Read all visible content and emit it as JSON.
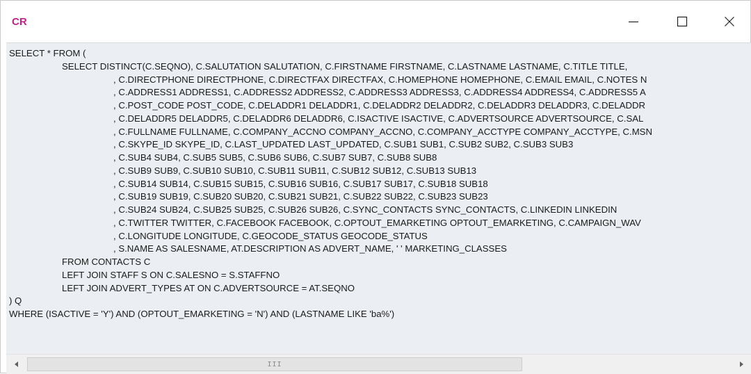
{
  "window": {
    "title": "CR",
    "title_color": "#c0228a",
    "controls": {
      "minimize_icon": "minimize-icon",
      "maximize_icon": "maximize-icon",
      "close_icon": "close-icon"
    }
  },
  "editor": {
    "background": "#ebeef2",
    "lines": [
      {
        "indent": 0,
        "text": "SELECT * FROM ("
      },
      {
        "indent": 1,
        "text": "SELECT DISTINCT(C.SEQNO), C.SALUTATION SALUTATION, C.FIRSTNAME FIRSTNAME, C.LASTNAME LASTNAME, C.TITLE TITLE, "
      },
      {
        "indent": 2,
        "text": ", C.DIRECTPHONE DIRECTPHONE, C.DIRECTFAX DIRECTFAX, C.HOMEPHONE HOMEPHONE, C.EMAIL EMAIL, C.NOTES N"
      },
      {
        "indent": 2,
        "text": ", C.ADDRESS1 ADDRESS1, C.ADDRESS2 ADDRESS2, C.ADDRESS3 ADDRESS3, C.ADDRESS4 ADDRESS4, C.ADDRESS5 A"
      },
      {
        "indent": 2,
        "text": ", C.POST_CODE POST_CODE, C.DELADDR1 DELADDR1, C.DELADDR2 DELADDR2, C.DELADDR3 DELADDR3, C.DELADDR"
      },
      {
        "indent": 2,
        "text": ", C.DELADDR5 DELADDR5, C.DELADDR6 DELADDR6, C.ISACTIVE ISACTIVE, C.ADVERTSOURCE ADVERTSOURCE, C.SAL"
      },
      {
        "indent": 2,
        "text": ", C.FULLNAME FULLNAME, C.COMPANY_ACCNO COMPANY_ACCNO, C.COMPANY_ACCTYPE COMPANY_ACCTYPE, C.MSN"
      },
      {
        "indent": 2,
        "text": ", C.SKYPE_ID SKYPE_ID, C.LAST_UPDATED LAST_UPDATED, C.SUB1 SUB1, C.SUB2 SUB2, C.SUB3 SUB3"
      },
      {
        "indent": 2,
        "text": ", C.SUB4 SUB4, C.SUB5 SUB5, C.SUB6 SUB6, C.SUB7 SUB7, C.SUB8 SUB8"
      },
      {
        "indent": 2,
        "text": ", C.SUB9 SUB9, C.SUB10 SUB10, C.SUB11 SUB11, C.SUB12 SUB12, C.SUB13 SUB13"
      },
      {
        "indent": 2,
        "text": ", C.SUB14 SUB14, C.SUB15 SUB15, C.SUB16 SUB16, C.SUB17 SUB17, C.SUB18 SUB18"
      },
      {
        "indent": 2,
        "text": ", C.SUB19 SUB19, C.SUB20 SUB20, C.SUB21 SUB21, C.SUB22 SUB22, C.SUB23 SUB23"
      },
      {
        "indent": 2,
        "text": ", C.SUB24 SUB24, C.SUB25 SUB25, C.SUB26 SUB26, C.SYNC_CONTACTS SYNC_CONTACTS, C.LINKEDIN LINKEDIN"
      },
      {
        "indent": 2,
        "text": ", C.TWITTER TWITTER, C.FACEBOOK FACEBOOK, C.OPTOUT_EMARKETING OPTOUT_EMARKETING, C.CAMPAIGN_WAV"
      },
      {
        "indent": 2,
        "text": ", C.LONGITUDE LONGITUDE, C.GEOCODE_STATUS GEOCODE_STATUS"
      },
      {
        "indent": 2,
        "text": ", S.NAME AS SALESNAME, AT.DESCRIPTION AS ADVERT_NAME, ' ' MARKETING_CLASSES"
      },
      {
        "indent": 1,
        "text": "FROM CONTACTS C"
      },
      {
        "indent": 1,
        "text": "LEFT JOIN STAFF S ON C.SALESNO = S.STAFFNO"
      },
      {
        "indent": 1,
        "text": "LEFT JOIN ADVERT_TYPES AT ON C.ADVERTSOURCE = AT.SEQNO"
      },
      {
        "indent": 0,
        "text": ") Q"
      },
      {
        "indent": 0,
        "text": "WHERE (ISACTIVE = 'Y') AND (OPTOUT_EMARKETING = 'N') AND (LASTNAME LIKE 'ba%')"
      }
    ]
  },
  "scrollbar": {
    "left_arrow_icon": "scroll-left-icon",
    "right_arrow_icon": "scroll-right-icon",
    "grip": "III"
  }
}
